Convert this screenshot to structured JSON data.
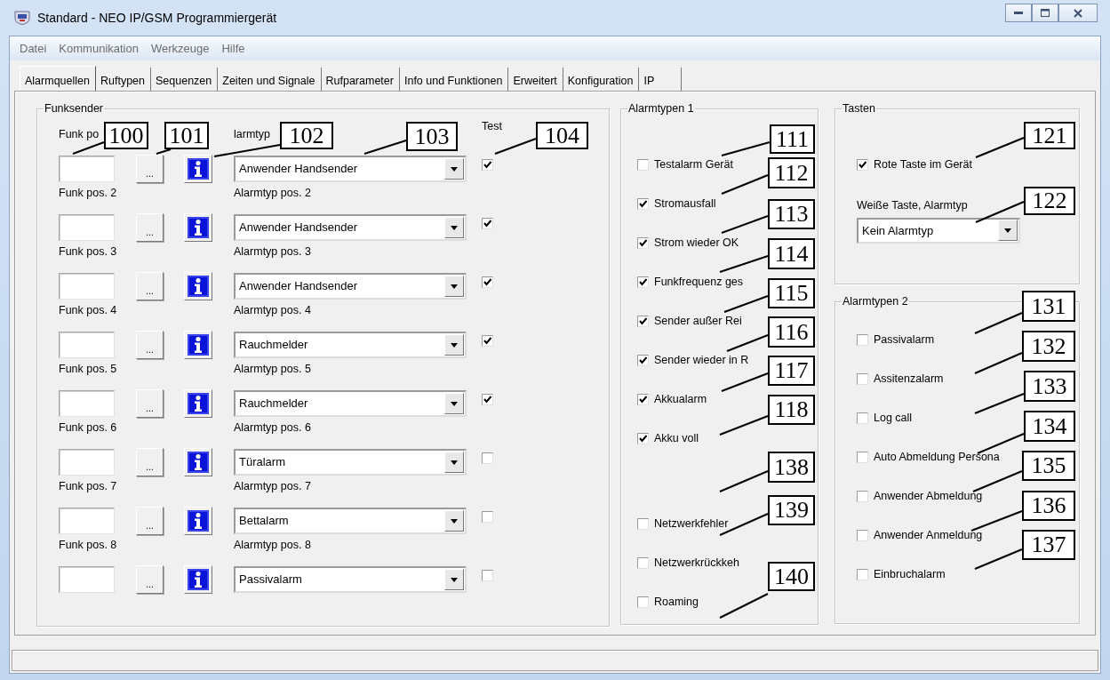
{
  "window": {
    "title": "Standard - NEO IP/GSM Programmiergerät"
  },
  "menu": [
    "Datei",
    "Kommunikation",
    "Werkzeuge",
    "Hilfe"
  ],
  "tabs": [
    {
      "label": "Alarmquellen",
      "selected": true
    },
    {
      "label": "Ruftypen",
      "selected": false
    },
    {
      "label": "Sequenzen",
      "selected": false
    },
    {
      "label": "Zeiten und Signale",
      "selected": false
    },
    {
      "label": "Rufparameter",
      "selected": false
    },
    {
      "label": "Info und Funktionen",
      "selected": false
    },
    {
      "label": "Erweitert",
      "selected": false
    },
    {
      "label": "Konfiguration",
      "selected": false
    },
    {
      "label": "IP",
      "selected": false
    }
  ],
  "funksender": {
    "title": "Funksender",
    "test_label": "Test",
    "rows": [
      {
        "funk_label": "Funk po",
        "browse": "...",
        "alarm_label": "larmtyp",
        "alarm_value": "Anwender Handsender",
        "test": true
      },
      {
        "funk_label": "Funk pos. 2",
        "browse": "...",
        "alarm_label": "Alarmtyp pos. 2",
        "alarm_value": "Anwender Handsender",
        "test": true
      },
      {
        "funk_label": "Funk pos. 3",
        "browse": "...",
        "alarm_label": "Alarmtyp pos. 3",
        "alarm_value": "Anwender Handsender",
        "test": true
      },
      {
        "funk_label": "Funk pos. 4",
        "browse": "...",
        "alarm_label": "Alarmtyp pos. 4",
        "alarm_value": "Rauchmelder",
        "test": true
      },
      {
        "funk_label": "Funk pos. 5",
        "browse": "...",
        "alarm_label": "Alarmtyp pos. 5",
        "alarm_value": "Rauchmelder",
        "test": true
      },
      {
        "funk_label": "Funk pos. 6",
        "browse": "...",
        "alarm_label": "Alarmtyp pos. 6",
        "alarm_value": "Türalarm",
        "test": false
      },
      {
        "funk_label": "Funk pos. 7",
        "browse": "...",
        "alarm_label": "Alarmtyp pos. 7",
        "alarm_value": "Bettalarm",
        "test": false
      },
      {
        "funk_label": "Funk pos. 8",
        "browse": "...",
        "alarm_label": "Alarmtyp pos. 8",
        "alarm_value": "Passivalarm",
        "test": false
      }
    ]
  },
  "alarmtypen_1": {
    "title": "Alarmtypen 1",
    "items": [
      {
        "label": "Testalarm Gerät",
        "checked": false
      },
      {
        "label": "Stromausfall",
        "checked": true
      },
      {
        "label": "Strom wieder OK",
        "checked": true
      },
      {
        "label": "Funkfrequenz ges",
        "checked": true
      },
      {
        "label": "Sender außer Rei",
        "checked": true
      },
      {
        "label": "Sender wieder in R",
        "checked": true
      },
      {
        "label": "Akkualarm",
        "checked": true
      },
      {
        "label": "Akku voll",
        "checked": true
      }
    ],
    "network_items": [
      {
        "label": "Netzwerkfehler",
        "checked": false
      },
      {
        "label": "Netzwerkrückkeh",
        "checked": false
      },
      {
        "label": "Roaming",
        "checked": false
      }
    ]
  },
  "tasten": {
    "title": "Tasten",
    "red_button": {
      "label": "Rote Taste im Gerät",
      "checked": true
    },
    "white_button": {
      "label": "Weiße Taste, Alarmtyp",
      "value": "Kein Alarmtyp"
    }
  },
  "alarmtypen_2": {
    "title": "Alarmtypen 2",
    "items": [
      {
        "label": "Passivalarm",
        "checked": false
      },
      {
        "label": "Assitenzalarm",
        "checked": false
      },
      {
        "label": "Log call",
        "checked": false
      },
      {
        "label": "Auto Abmeldung Persona",
        "checked": false
      },
      {
        "label": "Anwender Abmeldung",
        "checked": false
      },
      {
        "label": "Anwender Anmeldung",
        "checked": false
      },
      {
        "label": "Einbruchalarm",
        "checked": false
      }
    ]
  },
  "callouts": [
    "100",
    "101",
    "102",
    "103",
    "104",
    "111",
    "112",
    "113",
    "114",
    "115",
    "116",
    "117",
    "118",
    "138",
    "139",
    "140",
    "121",
    "122",
    "131",
    "132",
    "133",
    "134",
    "135",
    "136",
    "137"
  ]
}
